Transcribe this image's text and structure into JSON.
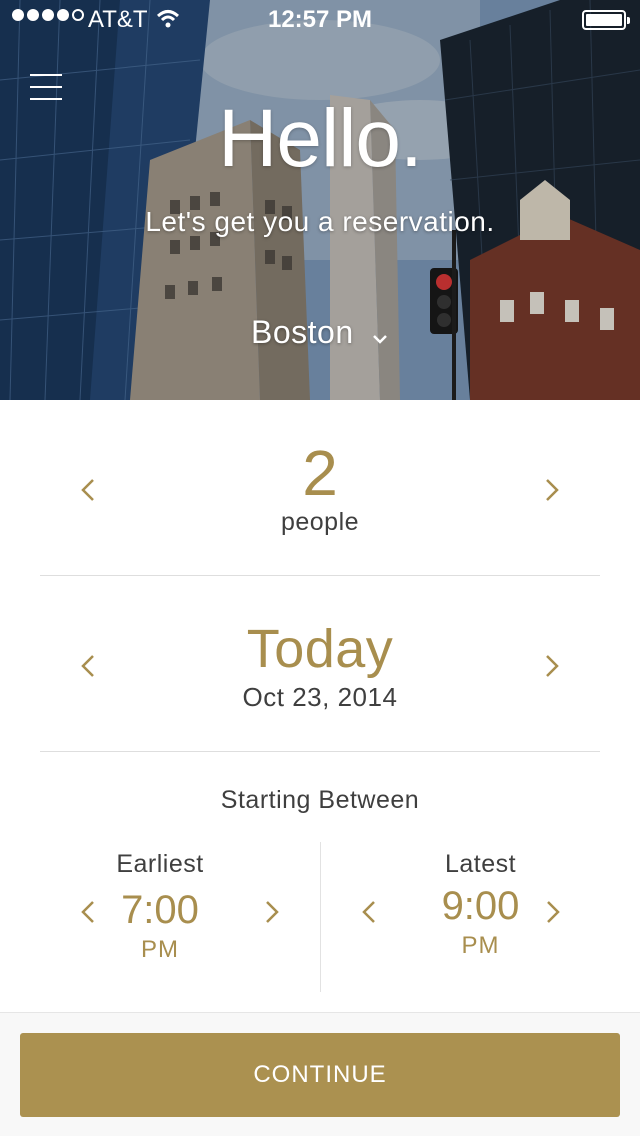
{
  "status_bar": {
    "carrier": "AT&T",
    "time": "12:57 PM",
    "signal_bars_filled": 4,
    "signal_bars_total": 5
  },
  "hero": {
    "greeting": "Hello.",
    "subtitle": "Let's get you a reservation.",
    "city": "Boston",
    "icons": {
      "menu": "hamburger-menu-icon",
      "city_dropdown": "chevron-down-icon"
    }
  },
  "party": {
    "count": "2",
    "unit": "people"
  },
  "date": {
    "label": "Today",
    "full": "Oct 23, 2014"
  },
  "time_window": {
    "heading": "Starting Between",
    "earliest": {
      "label": "Earliest",
      "time": "7:00",
      "period": "PM"
    },
    "latest": {
      "label": "Latest",
      "time": "9:00",
      "period": "PM"
    }
  },
  "footer": {
    "continue_label": "CONTINUE"
  },
  "colors": {
    "accent": "#a88e4e",
    "button": "#ab9150",
    "text": "#3f3f3f",
    "divider": "#dedede"
  }
}
